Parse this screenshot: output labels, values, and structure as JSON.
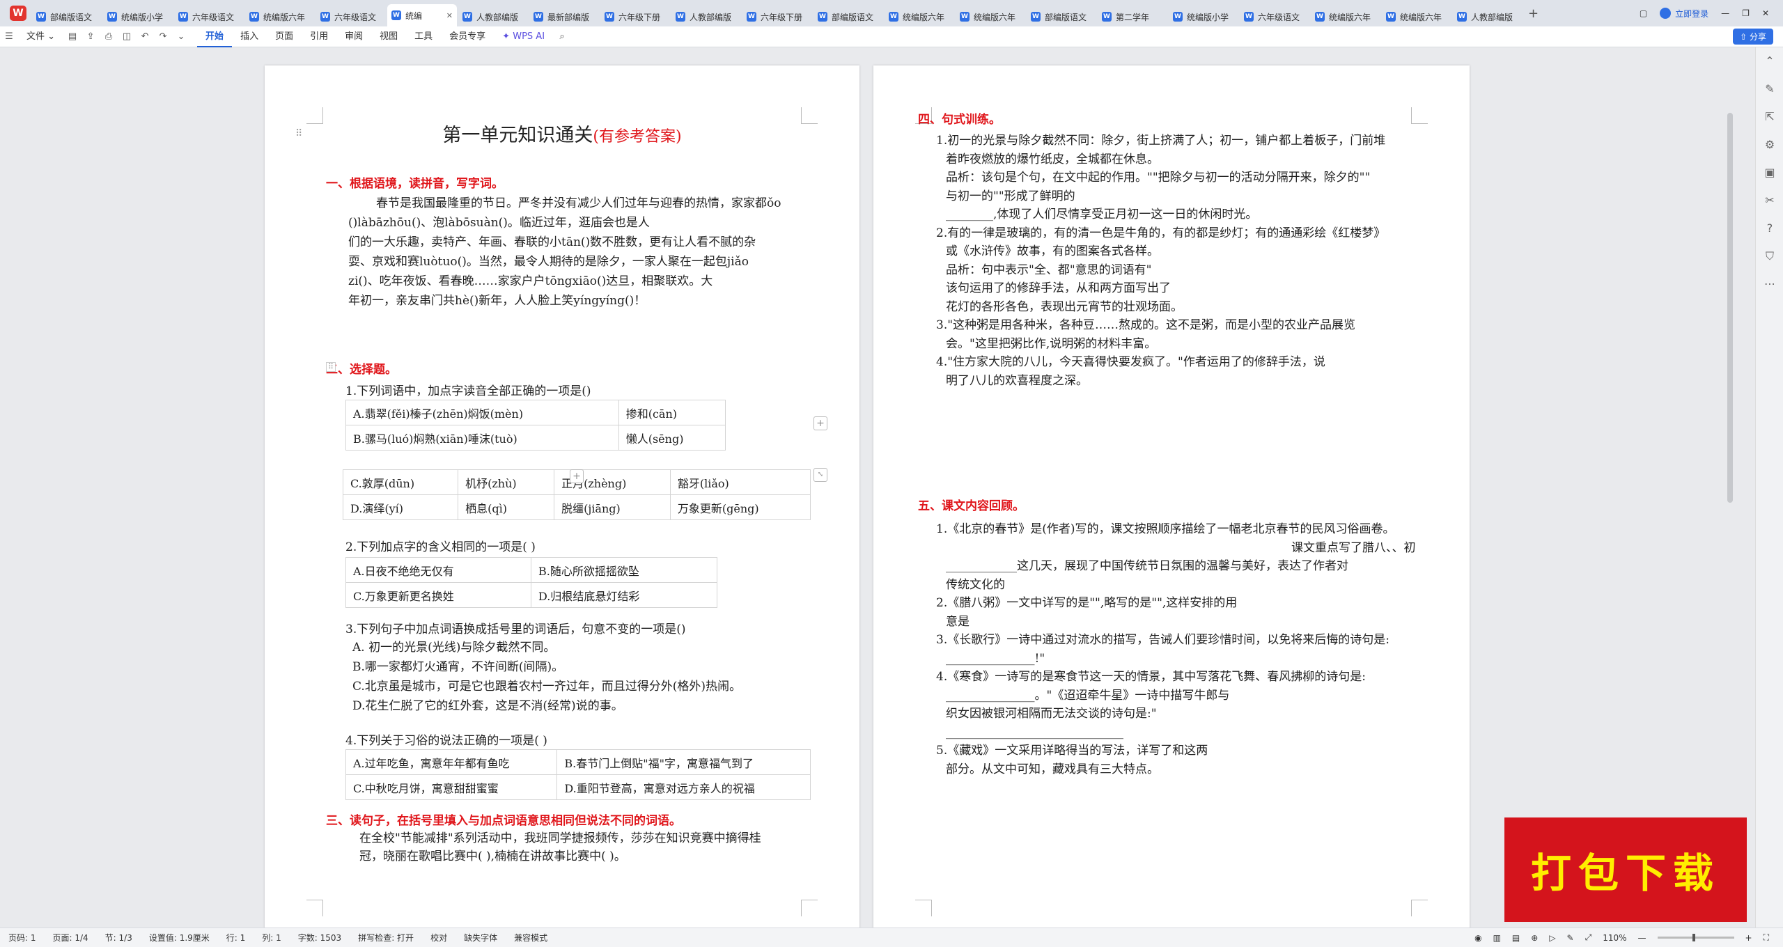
{
  "tabs": [
    "部编版语文",
    "统编版小学",
    "六年级语文",
    "统编版六年",
    "六年级语文",
    "统编",
    "人教部编版",
    "最新部编版",
    "六年级下册",
    "人教部编版",
    "六年级下册",
    "部编版语文",
    "统编版六年",
    "统编版六年",
    "部编版语文",
    "第二学年",
    "统编版小学",
    "六年级语文",
    "统编版六年",
    "统编版六年",
    "人教部编版"
  ],
  "titlebar": {
    "login": "立即登录"
  },
  "toolbar": {
    "file": "文件",
    "menus": [
      "开始",
      "插入",
      "页面",
      "引用",
      "审阅",
      "视图",
      "工具",
      "会员专享"
    ],
    "wps_ai": "WPS AI",
    "share": "分享"
  },
  "page1": {
    "title": "第一单元知识通关",
    "title_note": "(有参考答案)",
    "s1": "一、根据语境，读拼音，写字词。",
    "s1_lines": [
      "春节是我国最隆重的节日。严冬并没有减少人们过年与迎春的热情，家家都ǒo",
      "()làbāzhōu()、泡làbōsuàn()。临近过年，逛庙会也是人",
      "们的一大乐趣，卖特产、年画、春联的小tān()数不胜数，更有让人看不腻的杂",
      "耍、京戏和赛luòtuo()。当然，最令人期待的是除夕，一家人聚在一起包jiǎo",
      "zi()、吃年夜饭、看春晚……家家户户tōngxiāo()达旦，相聚联欢。大",
      "年初一，亲友串门共hè()新年，人人脸上笑yíngyíng()！"
    ],
    "s2": "二、选择题。",
    "q1": "1.下列词语中，加点字读音全部正确的一项是()",
    "q1_rows": [
      [
        "A.翡翠(fěi)榛子(zhēn)焖饭(mèn)",
        "掺和(cān)"
      ],
      [
        "B.骡马(luó)焖熟(xiān)唾沫(tuò)",
        "懒人(sēng)"
      ]
    ],
    "q1_rows2": [
      [
        "C.敦厚(dūn)",
        "机杼(zhù)",
        "正月(zhèng)",
        "豁牙(liǎo)"
      ],
      [
        "D.演绎(yí)",
        "栖息(qì)",
        "脱缰(jiāng)",
        "万象更新(gēng)"
      ]
    ],
    "q2": "2.下列加点字的含义相同的一项是(       )",
    "q2_rows": [
      [
        "A.日夜不绝绝无仅有",
        "B.随心所欲摇摇欲坠"
      ],
      [
        "C.万象更新更名换姓",
        "D.归根结底悬灯结彩"
      ]
    ],
    "q3": "3.下列句子中加点词语换成括号里的词语后，句意不变的一项是()",
    "q3_opts": [
      "A. 初一的光景(光线)与除夕截然不同。",
      "B.哪一家都灯火通宵，不许间断(间隔)。",
      "C.北京虽是城市，可是它也跟着农村一齐过年，而且过得分外(格外)热闹。",
      "D.花生仁脱了它的红外套，这是不消(经常)说的事。"
    ],
    "q4": "4.下列关于习俗的说法正确的一项是(       )",
    "q4_rows": [
      [
        "A.过年吃鱼，寓意年年都有鱼吃",
        "B.春节门上倒贴\"福\"字，寓意福气到了"
      ],
      [
        "C.中秋吃月饼，寓意甜甜蜜蜜",
        "D.重阳节登高，寓意对远方亲人的祝福"
      ]
    ],
    "s3": "三、读句子，在括号里填入与加点词语意思相同但说法不同的词语。",
    "s3_lines": [
      "在全校\"节能减排\"系列活动中，我班同学捷报频传，莎莎在知识竞赛中摘得桂",
      "冠，晓丽在歌唱比赛中(            ),楠楠在讲故事比赛中(            )。"
    ]
  },
  "page2": {
    "s4": "四、句式训练。",
    "s4_lines": [
      "1.初一的光景与除夕截然不同：除夕，街上挤满了人；初一，铺户都上着板子，门前堆",
      "着昨夜燃放的爆竹纸皮，全城都在休息。",
      "品析：该句是个句，在文中起的作用。\"\"把除夕与初一的活动分隔开来，除夕的\"\"",
      "与初一的\"\"形成了鲜明的",
      "________,体现了人们尽情享受正月初一这一日的休闲时光。",
      "2.有的一律是玻璃的，有的清一色是牛角的，有的都是纱灯；有的通通彩绘《红楼梦》",
      "或《水浒传》故事，有的图案各式各样。",
      "品析：句中表示\"全、都\"意思的词语有\"",
      "该句运用了的修辞手法，从和两方面写出了",
      "花灯的各形各色，表现出元宵节的壮观场面。",
      "3.\"这种粥是用各种米，各种豆……熬成的。这不是粥，而是小型的农业产品展览",
      "会。\"这里把粥比作,说明粥的材料丰富。",
      "4.\"住方家大院的八儿，今天喜得快要发疯了。\"作者运用了的修辞手法，说",
      "明了八儿的欢喜程度之深。"
    ],
    "s5": "五、课文内容回顾。",
    "s5_lines": [
      "1.《北京的春节》是(作者)写的，课文按照顺序描绘了一幅老北京春节的民风习俗画卷。",
      "课文重点写了腊八、、初",
      "____________这几天，展现了中国传统节日氛围的温馨与美好，表达了作者对",
      "传统文化的",
      "2.《腊八粥》一文中详写的是\"\",略写的是\"\",这样安排的用",
      "意是",
      "3.《长歌行》一诗中通过对流水的描写，告诫人们要珍惜时间，以免将来后悔的诗句是:",
      "_______________!\"",
      "4.《寒食》一诗写的是寒食节这一天的情景，其中写落花飞舞、春风拂柳的诗句是:",
      "_______________。\"《迢迢牵牛星》一诗中描写牛郎与",
      "织女因被银河相隔而无法交谈的诗句是:\"",
      "______________________________",
      "5.《藏戏》一文采用详略得当的写法，详写了和这两",
      "部分。从文中可知，藏戏具有三大特点。"
    ]
  },
  "status": {
    "items": [
      "页码: 1",
      "页面: 1/4",
      "节: 1/3",
      "设置值: 1.9厘米",
      "行: 1",
      "列: 1",
      "字数: 1503",
      "拼写检查: 打开",
      "校对",
      "缺失字体",
      "兼容模式"
    ],
    "zoom": "110%"
  },
  "banner": "打包下载"
}
